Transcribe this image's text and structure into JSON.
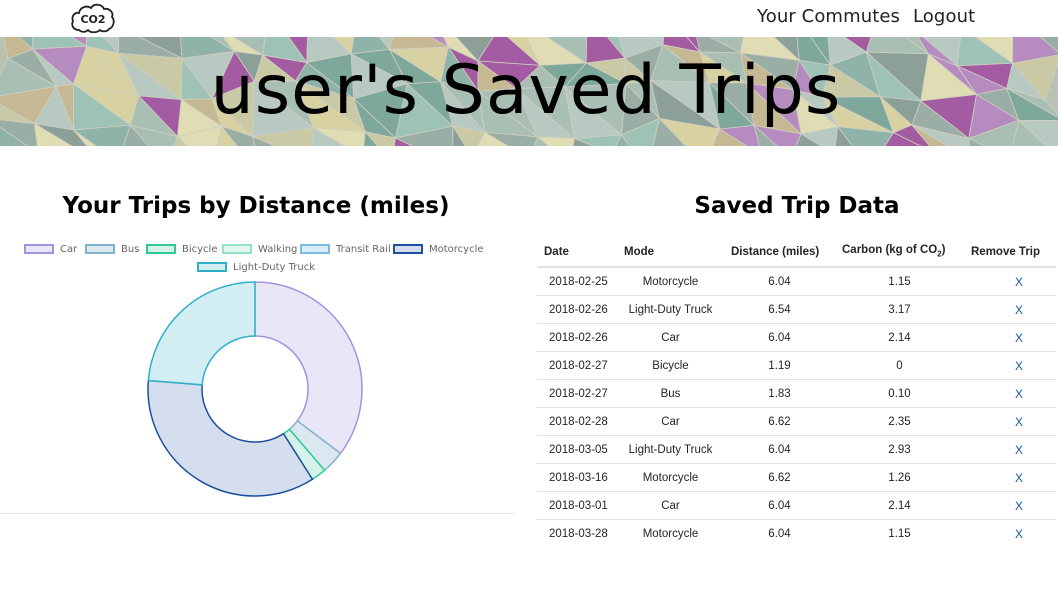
{
  "nav": {
    "logo_text": "CO2",
    "links": [
      {
        "label": "Your Commutes"
      },
      {
        "label": "Logout"
      }
    ]
  },
  "hero": {
    "title": "user's Saved Trips"
  },
  "chart_panel": {
    "title": "Your Trips by Distance (miles)"
  },
  "chart_data": {
    "type": "doughnut",
    "title": "Your Trips by Distance (miles)",
    "legend_position": "top",
    "categories": [
      "Car",
      "Bus",
      "Bicycle",
      "Walking",
      "Transit Rail",
      "Motorcycle",
      "Light-Duty Truck"
    ],
    "values": [
      18.7,
      1.83,
      1.19,
      0,
      0,
      18.7,
      12.58
    ],
    "fill_colors": [
      "#e9e6f7",
      "#dbe8ef",
      "#d5f3e8",
      "#e3f6f0",
      "#d9ecf7",
      "#d4deee",
      "#d3eef3"
    ],
    "border_colors": [
      "#a393e0",
      "#7fb3cc",
      "#2ec995",
      "#94e3c4",
      "#79bde4",
      "#1e4f9c",
      "#2fb0c9"
    ]
  },
  "table_panel": {
    "title": "Saved Trip Data",
    "headers": {
      "date": "Date",
      "mode": "Mode",
      "distance": "Distance (miles)",
      "carbon_prefix": "Carbon (kg of CO",
      "carbon_sub": "2",
      "carbon_suffix": ")",
      "remove": "Remove Trip"
    },
    "remove_label": "X",
    "rows": [
      {
        "date": "2018-02-25",
        "mode": "Motorcycle",
        "distance": "6.04",
        "carbon": "1.15"
      },
      {
        "date": "2018-02-26",
        "mode": "Light-Duty Truck",
        "distance": "6.54",
        "carbon": "3.17"
      },
      {
        "date": "2018-02-26",
        "mode": "Car",
        "distance": "6.04",
        "carbon": "2.14"
      },
      {
        "date": "2018-02-27",
        "mode": "Bicycle",
        "distance": "1.19",
        "carbon": "0"
      },
      {
        "date": "2018-02-27",
        "mode": "Bus",
        "distance": "1.83",
        "carbon": "0.10"
      },
      {
        "date": "2018-02-28",
        "mode": "Car",
        "distance": "6.62",
        "carbon": "2.35"
      },
      {
        "date": "2018-03-05",
        "mode": "Light-Duty Truck",
        "distance": "6.04",
        "carbon": "2.93"
      },
      {
        "date": "2018-03-16",
        "mode": "Motorcycle",
        "distance": "6.62",
        "carbon": "1.26"
      },
      {
        "date": "2018-03-01",
        "mode": "Car",
        "distance": "6.04",
        "carbon": "2.14"
      },
      {
        "date": "2018-03-28",
        "mode": "Motorcycle",
        "distance": "6.04",
        "carbon": "1.15"
      }
    ]
  },
  "icons": {
    "logo": "cloud-co2-logo-icon"
  }
}
